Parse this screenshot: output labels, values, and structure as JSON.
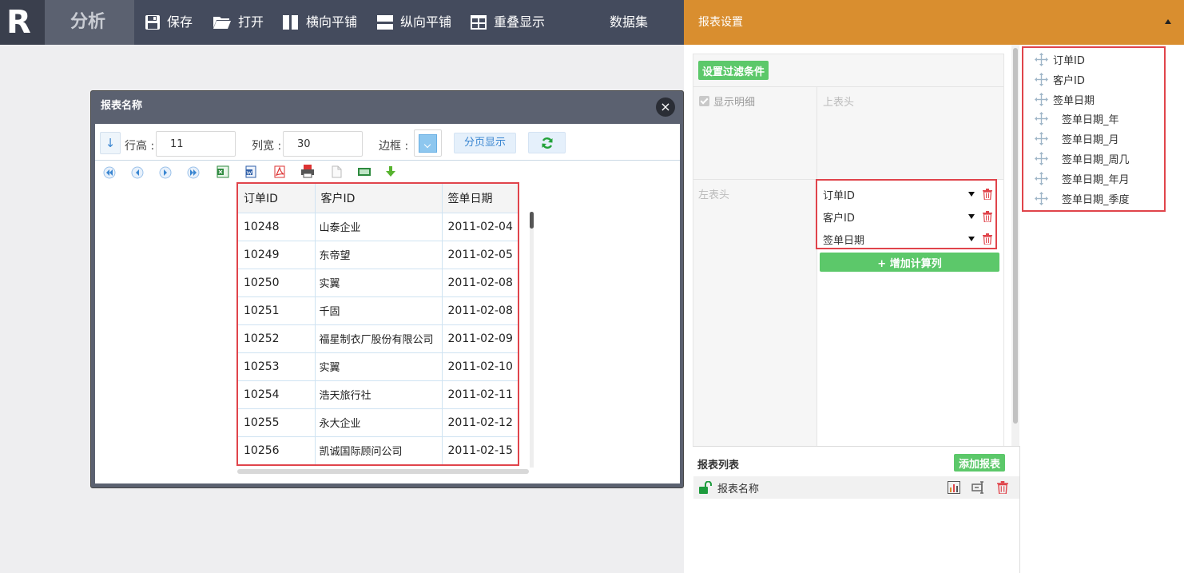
{
  "app": {
    "logo_letter": "R",
    "brand": "分析"
  },
  "toolbar": {
    "save": "保存",
    "open": "打开",
    "tile_horizontal": "横向平铺",
    "tile_vertical": "纵向平铺",
    "overlap": "重叠显示",
    "dataset": "数据集"
  },
  "settings": {
    "title": "报表设置",
    "filter_button": "设置过滤条件",
    "show_detail": "显示明细",
    "top_header": "上表头",
    "left_header": "左表头",
    "left_fields": [
      "订单ID",
      "客户ID",
      "签单日期"
    ],
    "add_calc_column": "+ 增加计算列",
    "report_list_title": "报表列表",
    "add_report": "添加报表",
    "report_items": [
      "报表名称"
    ]
  },
  "field_tree": {
    "items": [
      {
        "label": "订单ID",
        "level": 0
      },
      {
        "label": "客户ID",
        "level": 0
      },
      {
        "label": "签单日期",
        "level": 0
      },
      {
        "label": "签单日期_年",
        "level": 1
      },
      {
        "label": "签单日期_月",
        "level": 1
      },
      {
        "label": "签单日期_周几",
        "level": 1
      },
      {
        "label": "签单日期_年月",
        "level": 1
      },
      {
        "label": "签单日期_季度",
        "level": 1
      }
    ]
  },
  "report_window": {
    "title": "报表名称",
    "close": "×",
    "row_height_label": "行高 :",
    "row_height_value": "11",
    "col_width_label": "列宽 :",
    "col_width_value": "30",
    "border_label": "边框 :",
    "paging_button": "分页显示",
    "sort_icon": "↓"
  },
  "table": {
    "columns": [
      "订单ID",
      "客户ID",
      "签单日期"
    ],
    "rows": [
      [
        "10248",
        "山泰企业",
        "2011-02-04"
      ],
      [
        "10249",
        "东帝望",
        "2011-02-05"
      ],
      [
        "10250",
        "实翼",
        "2011-02-08"
      ],
      [
        "10251",
        "千固",
        "2011-02-08"
      ],
      [
        "10252",
        "福星制衣厂股份有限公司",
        "2011-02-09"
      ],
      [
        "10253",
        "实翼",
        "2011-02-10"
      ],
      [
        "10254",
        "浩天旅行社",
        "2011-02-11"
      ],
      [
        "10255",
        "永大企业",
        "2011-02-12"
      ],
      [
        "10256",
        "凯诚国际顾问公司",
        "2011-02-15"
      ]
    ]
  },
  "colors": {
    "topbar": "#444b5d",
    "settings_header": "#d98e2f",
    "green_button": "#5cc86a",
    "highlight_red": "#e0444b",
    "accent_blue": "#3a86d1"
  }
}
